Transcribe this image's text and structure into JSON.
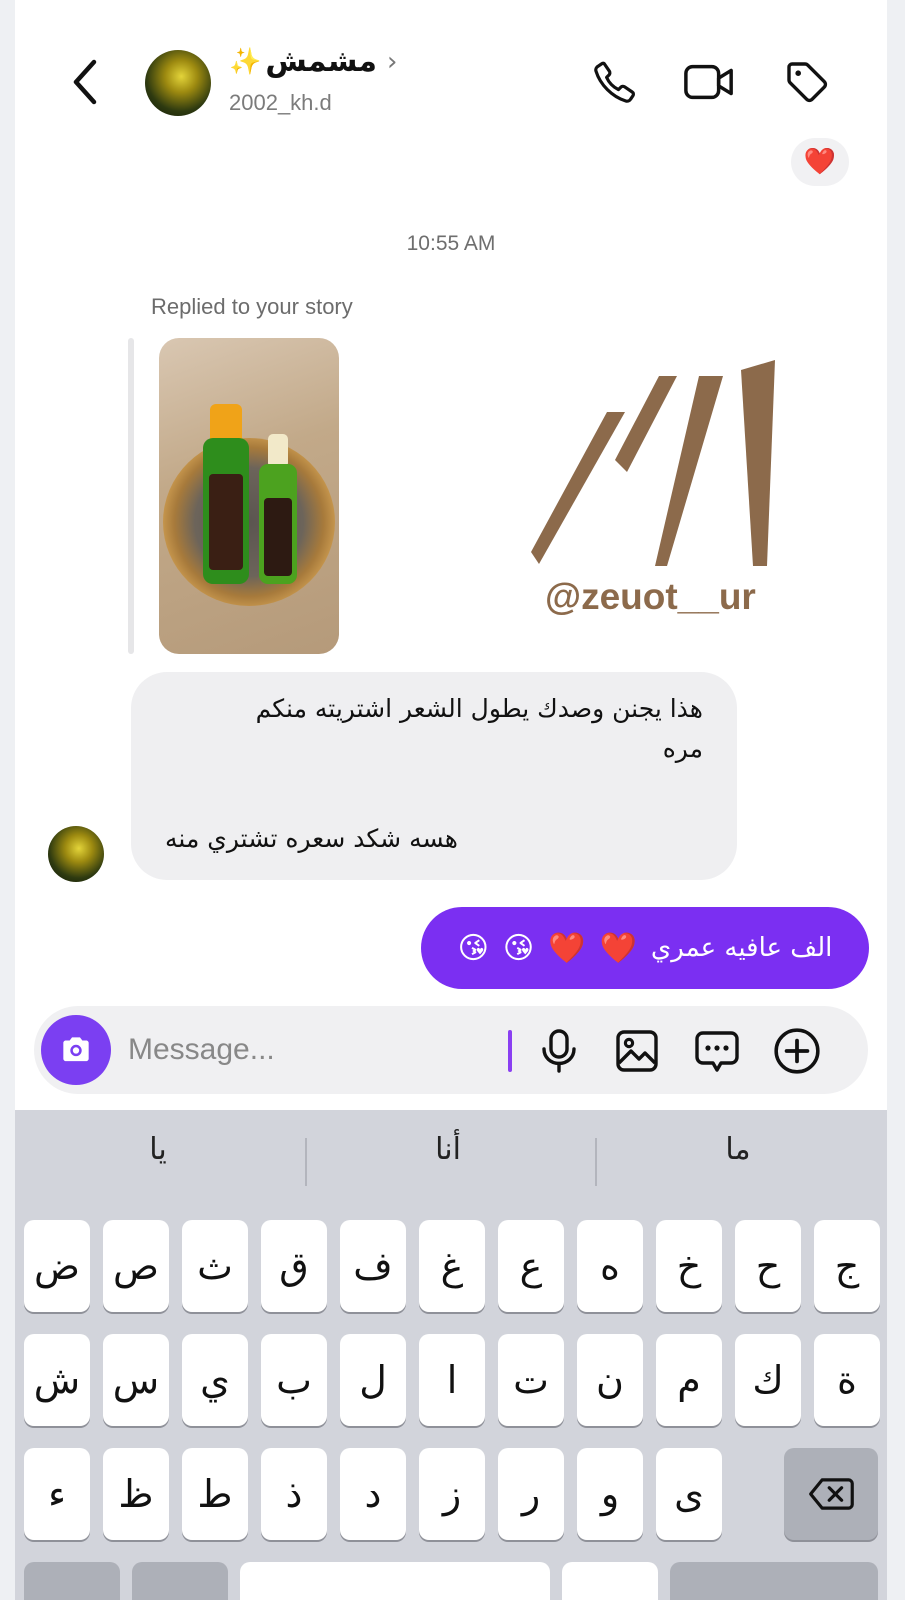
{
  "header": {
    "contact_name": "مشمش",
    "sparkle": "✨",
    "handle": "2002_kh.d"
  },
  "chat": {
    "heart_reaction": "❤️",
    "timestamp": "10:55 AM",
    "replied_label": "Replied to your story",
    "story_brand": "@zeuot__ur",
    "incoming_message": {
      "line1": "هذا يجنن وصدك يطول الشعر اشتريته منكم",
      "line2": "مره",
      "line3": "هسه شكد سعره تشتري منه"
    },
    "outgoing_message": {
      "text": "الف عافيه عمري",
      "emojis": [
        "❤️",
        "❤️",
        "😘",
        "😘"
      ]
    }
  },
  "composer": {
    "placeholder": "Message..."
  },
  "keyboard": {
    "suggestions": [
      "يا",
      "أنا",
      "ما"
    ],
    "row1": [
      "ض",
      "ص",
      "ث",
      "ق",
      "ف",
      "غ",
      "ع",
      "ه",
      "خ",
      "ح",
      "ج"
    ],
    "row2": [
      "ش",
      "س",
      "ي",
      "ب",
      "ل",
      "ا",
      "ت",
      "ن",
      "م",
      "ك",
      "ة"
    ],
    "row3": [
      "ء",
      "ظ",
      "ط",
      "ذ",
      "د",
      "ز",
      "ر",
      "و",
      "ى"
    ]
  },
  "colors": {
    "accent_purple": "#7b2ff2",
    "brand_brown": "#8c6a4b"
  }
}
